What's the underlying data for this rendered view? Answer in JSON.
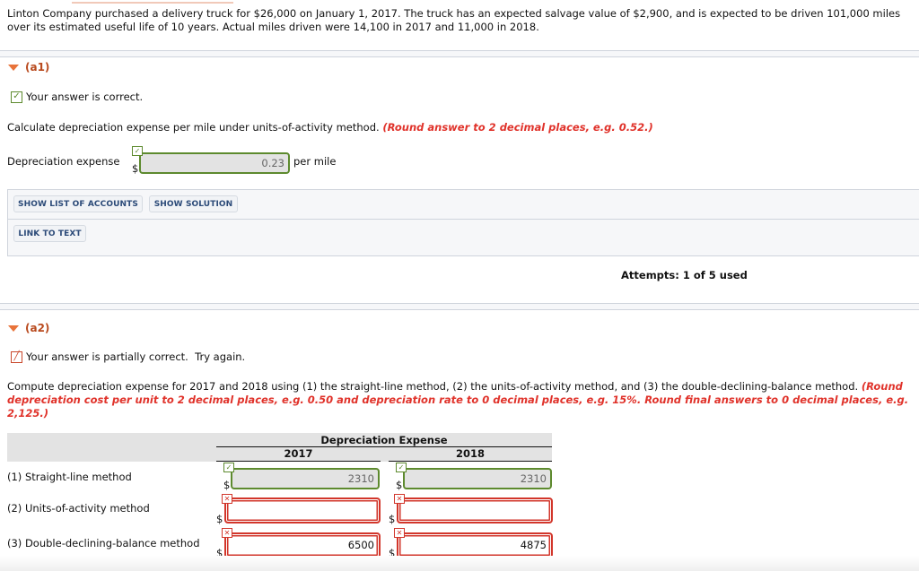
{
  "problem_text": "Linton Company purchased a delivery truck for $26,000 on January 1, 2017. The truck has an expected salvage value of $2,900, and is expected to be driven 101,000 miles over its estimated useful life of 10 years. Actual miles driven were 14,100 in 2017 and 11,000 in 2018.",
  "a1": {
    "label": "(a1)",
    "status_text": "Your answer is correct.",
    "status_icon": "check-icon",
    "instruction": "Calculate depreciation expense per mile under units-of-activity method.",
    "instruction_note": "(Round answer to 2 decimal places, e.g. 0.52.)",
    "field_label": "Depreciation expense",
    "currency": "$",
    "value": "0.23",
    "unit": "per mile",
    "buttons": {
      "show_accounts": "SHOW LIST OF ACCOUNTS",
      "show_solution": "SHOW SOLUTION",
      "link_to_text": "LINK TO TEXT"
    },
    "attempts": "Attempts: 1 of 5 used"
  },
  "a2": {
    "label": "(a2)",
    "status_text": "Your answer is partially correct.  Try again.",
    "status_icon": "pencil-icon",
    "instruction": "Compute depreciation expense for 2017 and 2018 using (1) the straight-line method, (2) the units-of-activity method, and (3) the double-declining-balance method.",
    "instruction_note": "(Round depreciation cost per unit to 2 decimal places, e.g. 0.50 and depreciation rate to 0 decimal places, e.g. 15%. Round final answers to 0 decimal places, e.g. 2,125.)",
    "table": {
      "group_header": "Depreciation Expense",
      "columns": [
        "2017",
        "2018"
      ],
      "currency": "$",
      "rows": [
        {
          "label": "(1) Straight-line method",
          "values": [
            "2310",
            "2310"
          ],
          "status": [
            "correct",
            "correct"
          ]
        },
        {
          "label": "(2) Units-of-activity method",
          "values": [
            "",
            ""
          ],
          "status": [
            "incorrect",
            "incorrect"
          ]
        },
        {
          "label": "(3) Double-declining-balance method",
          "values": [
            "6500",
            "4875"
          ],
          "status": [
            "incorrect",
            "incorrect"
          ]
        }
      ]
    }
  },
  "colors": {
    "correct": "#5d8a2e",
    "incorrect": "#d2362b",
    "accent_header": "#b94a1e",
    "note_red": "#e0322a",
    "button_text": "#2b4a78"
  }
}
